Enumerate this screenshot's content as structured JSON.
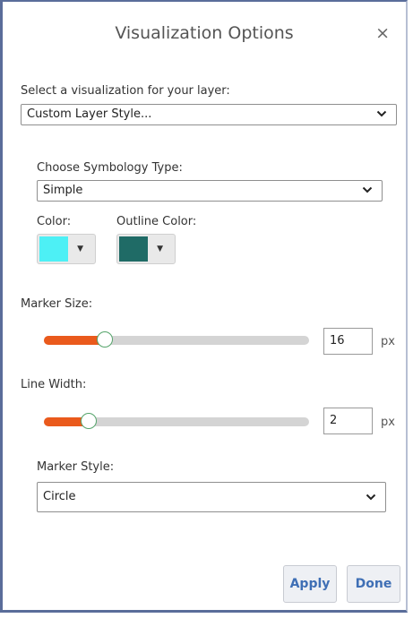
{
  "dialog": {
    "title": "Visualization Options",
    "close_glyph": "×"
  },
  "visualization": {
    "label": "Select a visualization for your layer:",
    "selected": "Custom Layer Style..."
  },
  "symbology": {
    "label": "Choose Symbology Type:",
    "selected": "Simple"
  },
  "colors": {
    "color_label": "Color:",
    "color_value": "#4df0f5",
    "outline_label": "Outline Color:",
    "outline_value": "#1f6b66",
    "dropdown_glyph": "▼"
  },
  "marker_size": {
    "label": "Marker Size:",
    "value": "16",
    "unit": "px",
    "level": 0.23
  },
  "line_width": {
    "label": "Line Width:",
    "value": "2",
    "unit": "px",
    "level": 0.17
  },
  "marker_style": {
    "label": "Marker Style:",
    "selected": "Circle"
  },
  "buttons": {
    "apply": "Apply",
    "done": "Done"
  },
  "theme": {
    "accent": "#3f6fb5",
    "slider_fill": "#ea5a1c",
    "border": "#5a6d9a"
  }
}
